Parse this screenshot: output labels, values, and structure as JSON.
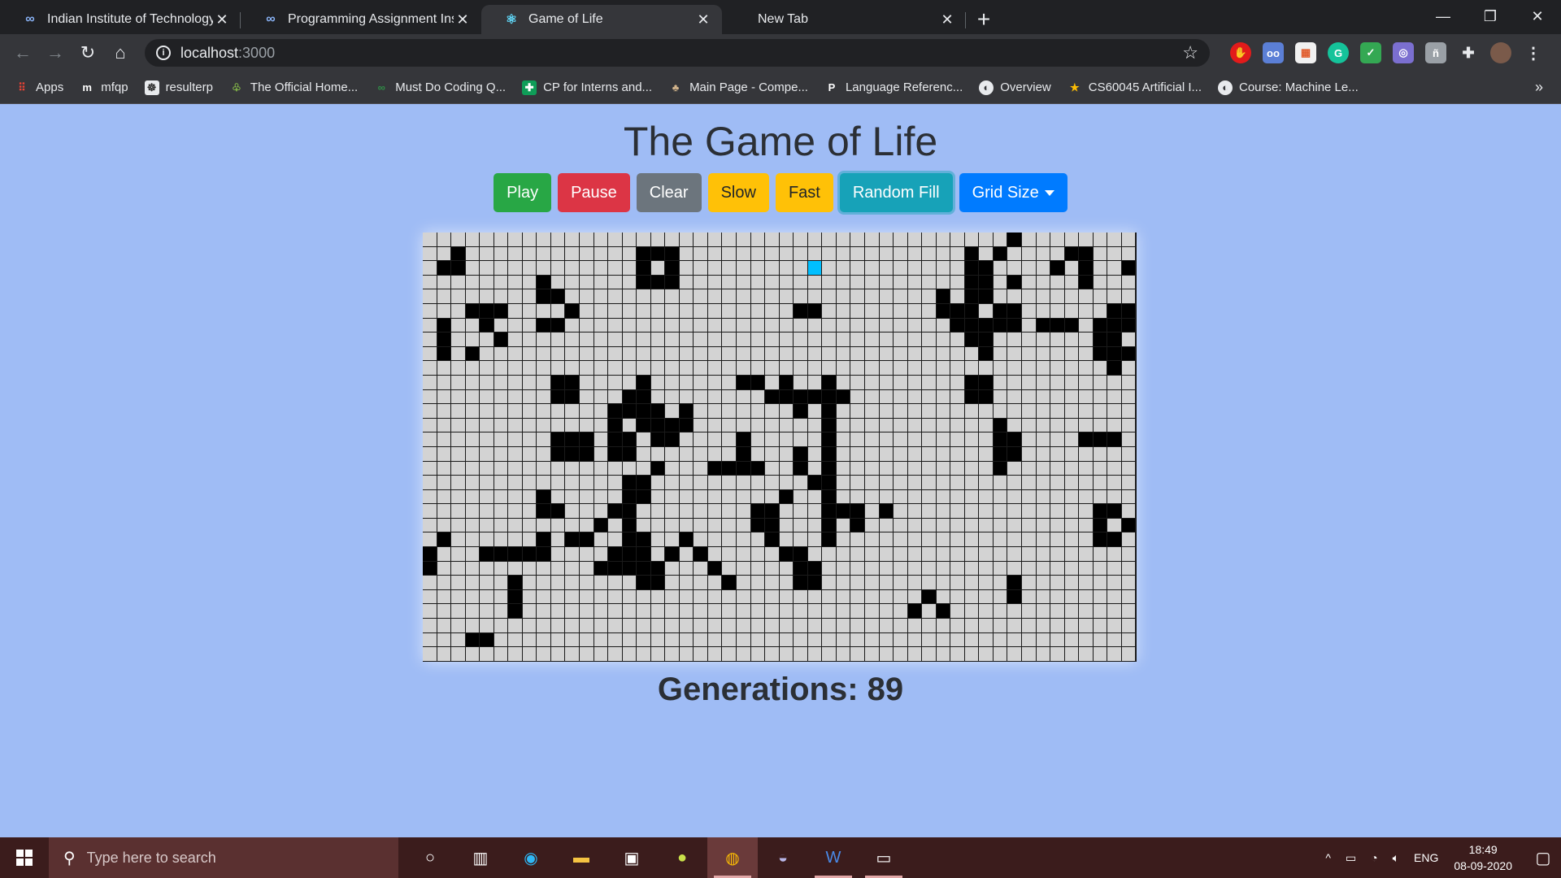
{
  "browser": {
    "tabs": [
      {
        "title": "Indian Institute of Technology (N",
        "icon": "infinity-icon",
        "active": false
      },
      {
        "title": "Programming Assignment Instru",
        "icon": "infinity-icon",
        "active": false
      },
      {
        "title": "Game of Life",
        "icon": "react-icon",
        "active": true
      },
      {
        "title": "New Tab",
        "icon": "none",
        "active": false
      }
    ],
    "new_tab_symbol": "+",
    "url_host": "localhost",
    "url_port": ":3000",
    "bookmarks": [
      {
        "label": "Apps",
        "icon": "apps-grid-icon"
      },
      {
        "label": "mfqp",
        "icon": "m-icon"
      },
      {
        "label": "resulterp",
        "icon": "iit-logo-icon"
      },
      {
        "label": "The Official Home...",
        "icon": "page-icon"
      },
      {
        "label": "Must Do Coding Q...",
        "icon": "gfg-icon"
      },
      {
        "label": "CP for Interns and...",
        "icon": "sheets-icon"
      },
      {
        "label": "Main Page - Compe...",
        "icon": "wiki-icon"
      },
      {
        "label": "Language Referenc...",
        "icon": "p-icon"
      },
      {
        "label": "Overview",
        "icon": "globe-icon"
      },
      {
        "label": "CS60045 Artificial I...",
        "icon": "star-icon"
      },
      {
        "label": "Course: Machine Le...",
        "icon": "globe-icon"
      }
    ]
  },
  "app": {
    "title": "The Game of Life",
    "buttons": {
      "play": "Play",
      "pause": "Pause",
      "clear": "Clear",
      "slow": "Slow",
      "fast": "Fast",
      "random": "Random Fill",
      "grid_size": "Grid Size"
    },
    "generations_label": "Generations:",
    "generations": "89",
    "grid": {
      "rows": 30,
      "cols": 50,
      "hover_cell": [
        2,
        27
      ],
      "cells": [
        "0000000000000000000000000000000000000000010000000000",
        "00100000000000011100000000000000000000101000011000",
        "01100000000000010100000000000000000000110000101001",
        "00000000100000011100000000000000000000110100001000",
        "00000000110000000000000000000000000010110000000000",
        "00011100001000000000000000110000000011101100000011",
        "01001000110000000000000000000000000001111101110111",
        "01000100000000000000000000000000000000110000000110",
        "01010000000000000000000000000000000000010000000111",
        "00000000000000000000000000000000000000000000000010",
        "00000000011000010000001101001000000000110000000000",
        "00000000011000110000000011111100000000110000000000",
        "00000000000001111010000000101000000000000000000000",
        "00000000000001011110000000001000000000001000000000",
        "00000000011101101100001000001000000000001100001110",
        "00000000011101100000001000101000000000001100000000",
        "00000000000000001000111100101000000000001000000000",
        "00000000000000110000000000011000000000000000000000",
        "00000000100000110000000001001000000000000000000000",
        "00000000110001100000000110001110100000000000000110",
        "00000000000010100000000110001010000000000000000101",
        "01000000101100110010000010001000000000000000000110",
        "10001111100001110101000001100000000000000000000000",
        "10000000000011111000100000110000000000000000000000",
        "00000010000000011000010000110000000000000100000000",
        "00000010000000000000000000000000000100000100000000",
        "00000010000000000000000000000000001010000000000000",
        "00000000000000000000000000000000000000000000000000",
        "00011000000000000000000000000000000000000000000000",
        "00000000000000000000000000000000000000000000000000"
      ]
    }
  },
  "taskbar": {
    "search_placeholder": "Type here to search",
    "language": "ENG",
    "time": "18:49",
    "date": "08-09-2020"
  }
}
